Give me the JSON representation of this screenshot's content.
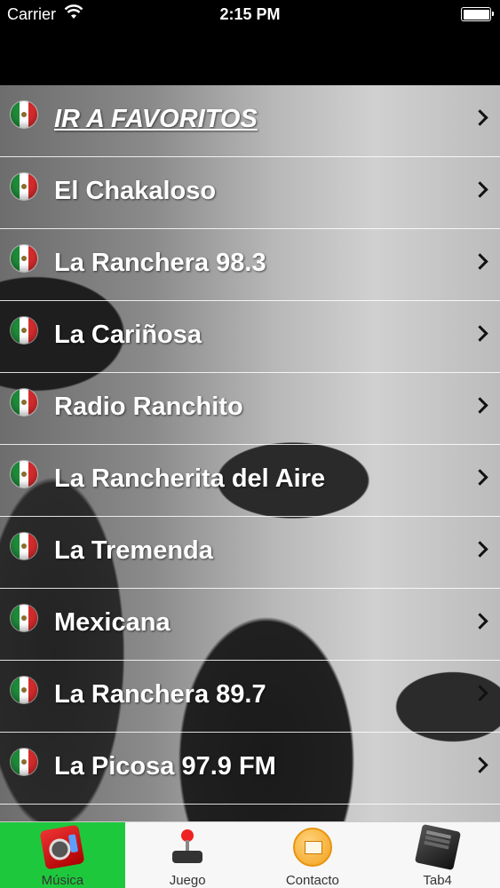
{
  "status_bar": {
    "carrier": "Carrier",
    "time": "2:15 PM",
    "wifi_icon": "wifi-icon",
    "battery_icon": "battery-icon",
    "battery_level": 1.0
  },
  "list": {
    "rows": [
      {
        "label": "IR A FAVORITOS",
        "icon": "mexico-flag-icon"
      },
      {
        "label": "El Chakaloso",
        "icon": "mexico-flag-icon"
      },
      {
        "label": "La Ranchera 98.3",
        "icon": "mexico-flag-icon"
      },
      {
        "label": "La Cariñosa",
        "icon": "mexico-flag-icon"
      },
      {
        "label": "Radio Ranchito",
        "icon": "mexico-flag-icon"
      },
      {
        "label": "La Rancherita del Aire",
        "icon": "mexico-flag-icon"
      },
      {
        "label": "La Tremenda",
        "icon": "mexico-flag-icon"
      },
      {
        "label": "Mexicana",
        "icon": "mexico-flag-icon"
      },
      {
        "label": "La Ranchera 89.7",
        "icon": "mexico-flag-icon"
      },
      {
        "label": "La Picosa 97.9 FM",
        "icon": "mexico-flag-icon"
      }
    ]
  },
  "tab_bar": {
    "active_color": "#1ec83c",
    "tabs": [
      {
        "label": "Música",
        "icon": "radio-icon",
        "active": true
      },
      {
        "label": "Juego",
        "icon": "joystick-icon",
        "active": false
      },
      {
        "label": "Contacto",
        "icon": "mail-icon",
        "active": false
      },
      {
        "label": "Tab4",
        "icon": "book-icon",
        "active": false
      }
    ]
  }
}
